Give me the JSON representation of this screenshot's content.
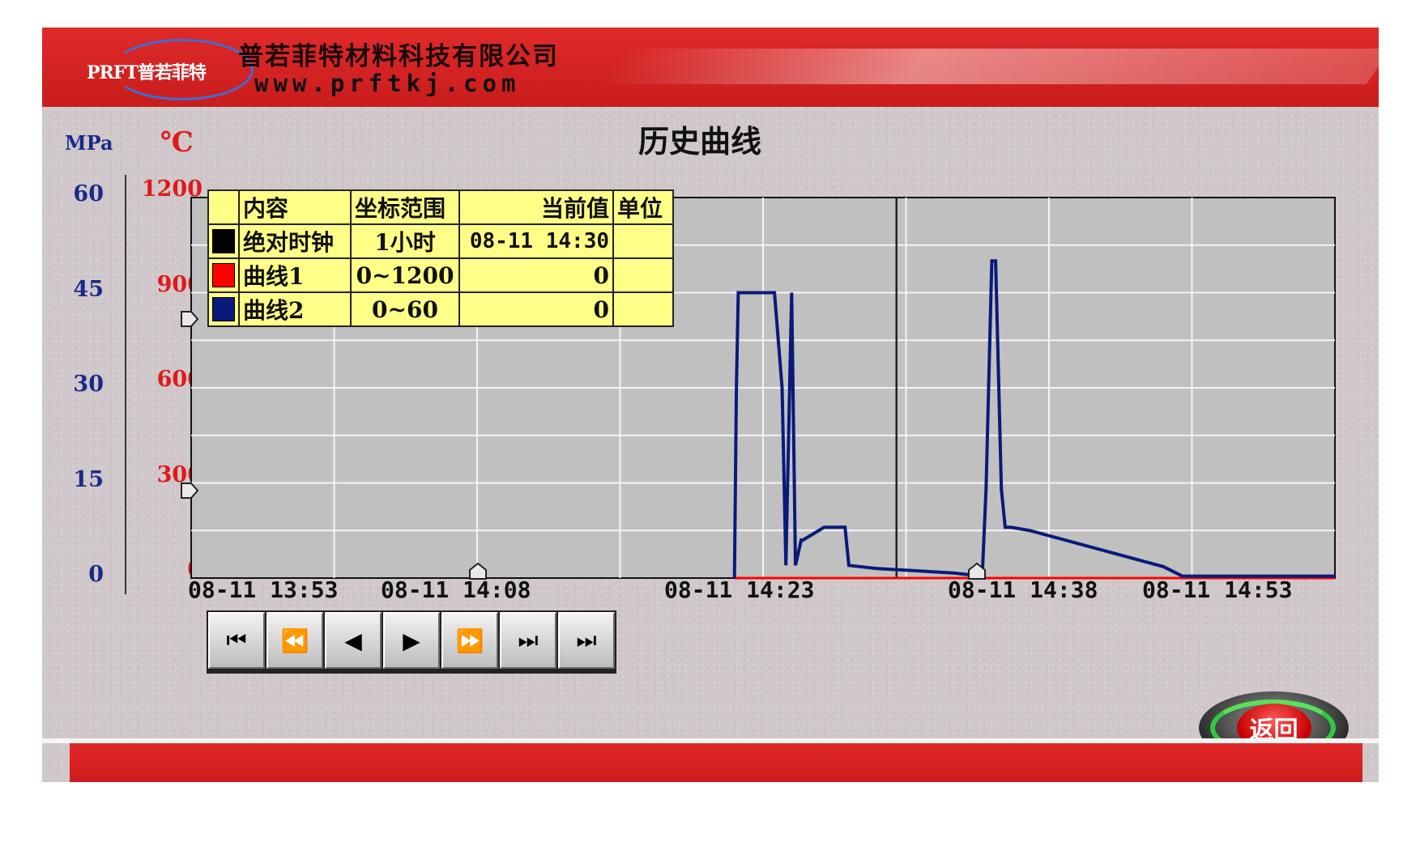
{
  "header": {
    "logo_text": "PRFT普若菲特",
    "company_name": "普若菲特材料科技有限公司",
    "company_url": "www.prftkj.com"
  },
  "page_title": "历史曲线",
  "axes": {
    "left_unit": "MPa",
    "right_unit": "℃",
    "left_ticks": [
      "60",
      "45",
      "30",
      "15",
      "0"
    ],
    "right_ticks": [
      "1200",
      "900",
      "600",
      "300",
      "0"
    ],
    "x_labels": [
      "08-11 13:53",
      "08-11 14:08",
      "08-11 14:23",
      "08-11 14:38",
      "08-11 14:53"
    ]
  },
  "legend": {
    "headers": [
      "内容",
      "坐标范围",
      "当前值",
      "单位"
    ],
    "rows": [
      {
        "name": "绝对时钟",
        "range": "1小时",
        "value": "08-11 14:30",
        "unit": "",
        "color": "#000000"
      },
      {
        "name": "曲线1",
        "range": "0~1200",
        "value": "0",
        "unit": "",
        "color": "#ff0000"
      },
      {
        "name": "曲线2",
        "range": "0~60",
        "value": "0",
        "unit": "",
        "color": "#0a1a7a"
      }
    ]
  },
  "nav_buttons": [
    {
      "name": "first-page",
      "glyph": "⏮"
    },
    {
      "name": "fast-backward",
      "glyph": "⏪"
    },
    {
      "name": "step-backward",
      "glyph": "◀"
    },
    {
      "name": "step-forward",
      "glyph": "▶"
    },
    {
      "name": "fast-forward",
      "glyph": "⏩"
    },
    {
      "name": "last-page",
      "glyph": "⏭"
    },
    {
      "name": "jump-current",
      "glyph": "⏭"
    }
  ],
  "return_label": "返回",
  "chart_data": {
    "type": "line",
    "x_unit": "minutes since 13:53",
    "xlim": [
      0,
      60
    ],
    "series": [
      {
        "name": "曲线1",
        "color": "#ff0000",
        "axis": "right",
        "x": [
          28.5,
          60
        ],
        "y": [
          0,
          0
        ]
      },
      {
        "name": "曲线2",
        "color": "#0a1a7a",
        "axis": "left",
        "x": [
          28.5,
          28.6,
          28.7,
          30,
          30.3,
          30.6,
          31,
          31.2,
          31.5,
          31.7,
          32,
          32.1,
          33.2,
          33.3,
          34.3,
          34.5,
          36,
          40,
          41.5,
          41.7,
          42,
          42.2,
          42.5,
          42.7,
          43,
          44,
          51,
          52,
          53,
          55,
          60
        ],
        "y": [
          0,
          30,
          45,
          45,
          45,
          45,
          30,
          2,
          45,
          2,
          6,
          6,
          8,
          8,
          8,
          2,
          1.5,
          0.8,
          0.3,
          14,
          50,
          50,
          14,
          8,
          8,
          7.5,
          1.8,
          0.3,
          0.3,
          0.3,
          0.3
        ]
      }
    ],
    "left_ylim": [
      0,
      60
    ],
    "right_ylim": [
      0,
      1200
    ],
    "cursor_time": "08-11 14:30",
    "grid": true
  }
}
